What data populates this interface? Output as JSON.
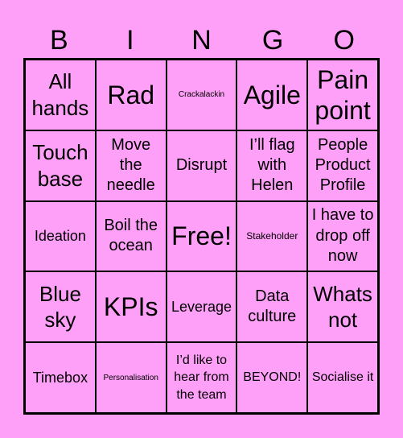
{
  "header": [
    "B",
    "I",
    "N",
    "G",
    "O"
  ],
  "colors": {
    "background": "#FFA0F8",
    "grid_line": "#000000",
    "text": "#000000"
  },
  "cells": [
    {
      "text": "All hands",
      "size": "s-l"
    },
    {
      "text": "Rad",
      "size": "s-xl"
    },
    {
      "text": "Crackalackin",
      "size": "s-xxs"
    },
    {
      "text": "Agile",
      "size": "s-xl"
    },
    {
      "text": "Pain point",
      "size": "s-xl"
    },
    {
      "text": "Touch base",
      "size": "s-l"
    },
    {
      "text": "Move the needle",
      "size": "s-m"
    },
    {
      "text": "Disrupt",
      "size": "s-m"
    },
    {
      "text": "I’ll flag with Helen",
      "size": "s-m"
    },
    {
      "text": "People Product Profile",
      "size": "s-m"
    },
    {
      "text": "Ideation",
      "size": "s-ms"
    },
    {
      "text": "Boil the ocean",
      "size": "s-m"
    },
    {
      "text": "Free!",
      "size": "s-xl"
    },
    {
      "text": "Stakeholder",
      "size": "s-xs"
    },
    {
      "text": "I have to drop off now",
      "size": "s-m"
    },
    {
      "text": "Blue sky",
      "size": "s-l"
    },
    {
      "text": "KPIs",
      "size": "s-xl"
    },
    {
      "text": "Leverage",
      "size": "s-ms"
    },
    {
      "text": "Data culture",
      "size": "s-m"
    },
    {
      "text": "Whats not",
      "size": "s-l"
    },
    {
      "text": "Timebox",
      "size": "s-ms"
    },
    {
      "text": "Personalisation",
      "size": "s-xxs"
    },
    {
      "text": "I’d like to hear from the team",
      "size": "s-s"
    },
    {
      "text": "BEYOND!",
      "size": "s-s"
    },
    {
      "text": "Socialise it",
      "size": "s-s"
    }
  ]
}
